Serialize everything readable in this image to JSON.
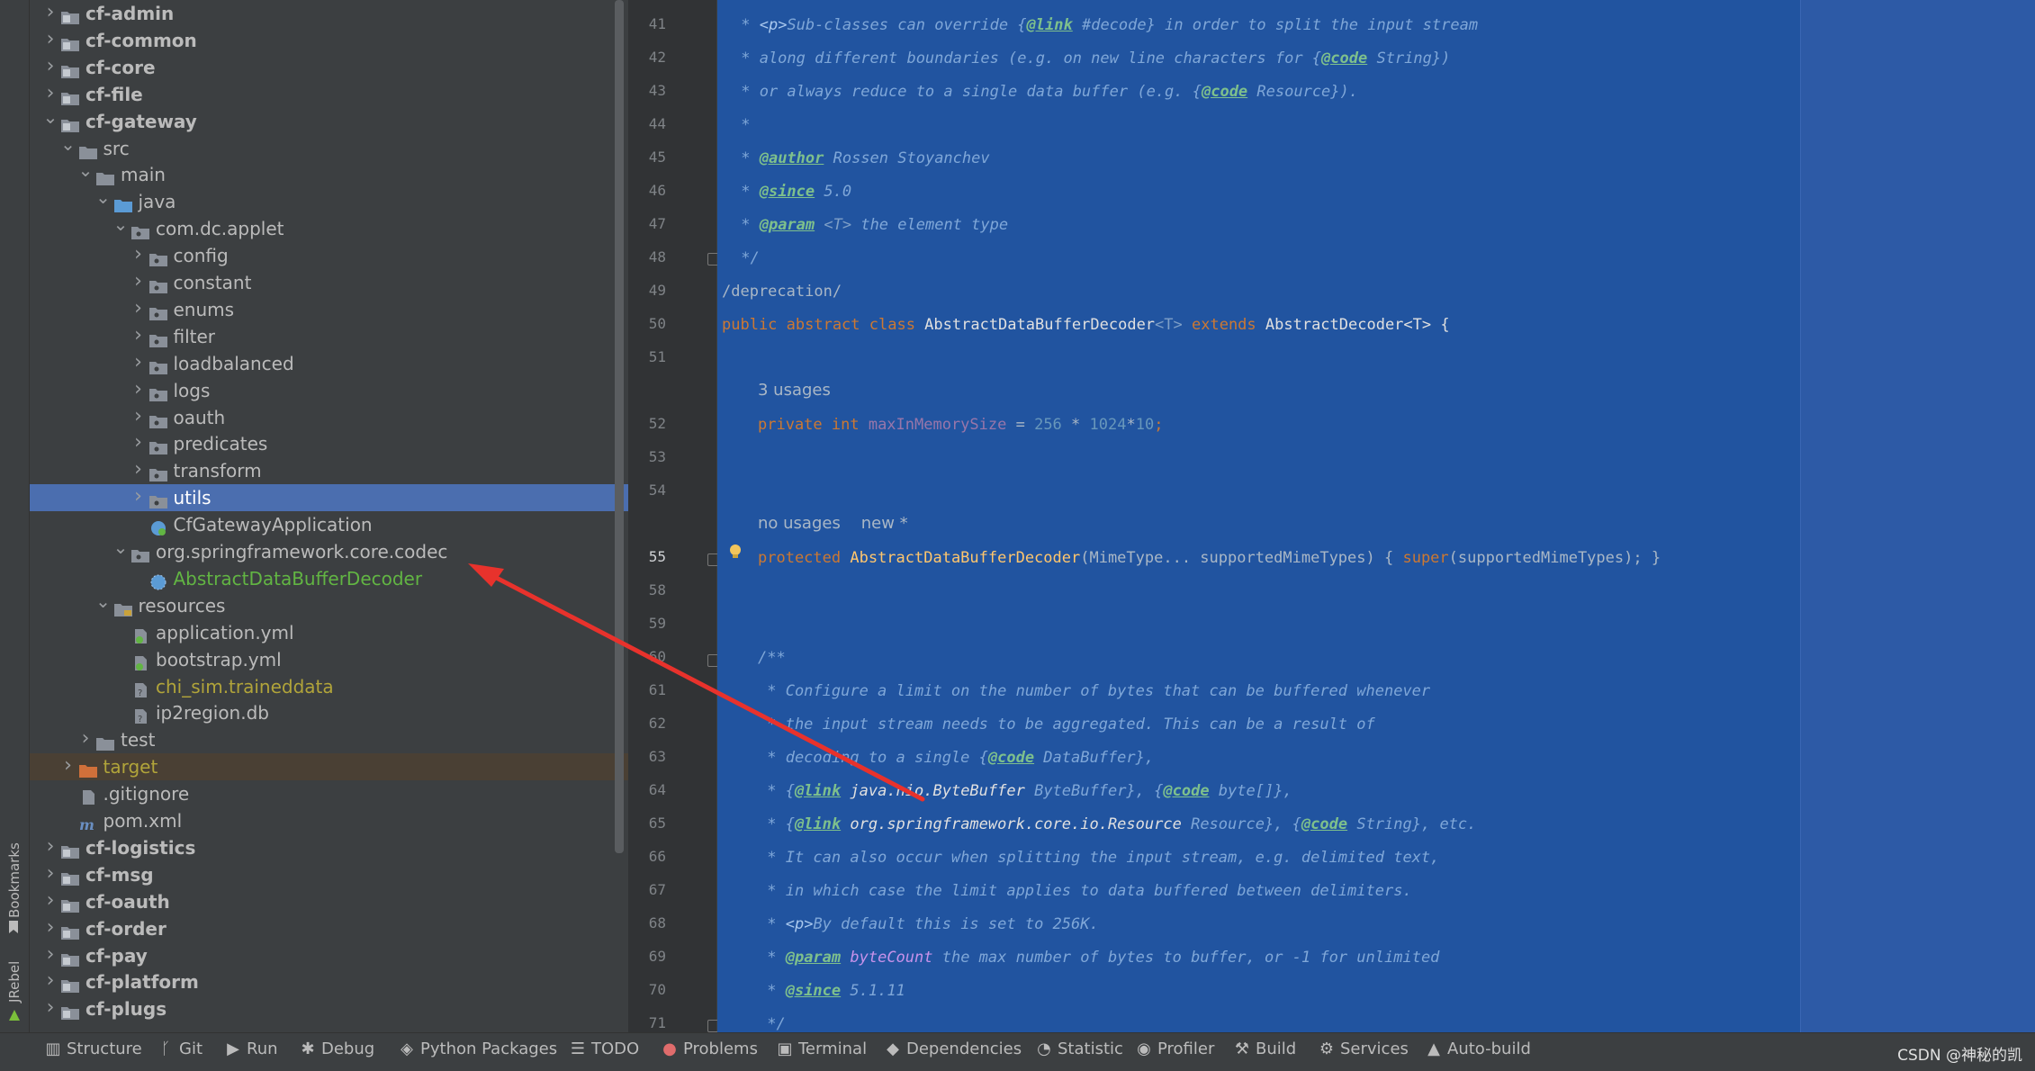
{
  "left_strip": {
    "bookmarks_label": "Bookmarks",
    "jrebel_label": "JRebel"
  },
  "project_tree": [
    {
      "name": "cf-admin",
      "level": 0,
      "arrow": "right",
      "icon": "module",
      "bold": true
    },
    {
      "name": "cf-common",
      "level": 0,
      "arrow": "right",
      "icon": "module",
      "bold": true
    },
    {
      "name": "cf-core",
      "level": 0,
      "arrow": "right",
      "icon": "module",
      "bold": true
    },
    {
      "name": "cf-file",
      "level": 0,
      "arrow": "right",
      "icon": "module",
      "bold": true
    },
    {
      "name": "cf-gateway",
      "level": 0,
      "arrow": "down",
      "icon": "module",
      "bold": true
    },
    {
      "name": "src",
      "level": 1,
      "arrow": "down",
      "icon": "folder"
    },
    {
      "name": "main",
      "level": 2,
      "arrow": "down",
      "icon": "folder"
    },
    {
      "name": "java",
      "level": 3,
      "arrow": "down",
      "icon": "source-folder"
    },
    {
      "name": "com.dc.applet",
      "level": 4,
      "arrow": "down",
      "icon": "package"
    },
    {
      "name": "config",
      "level": 5,
      "arrow": "right",
      "icon": "package"
    },
    {
      "name": "constant",
      "level": 5,
      "arrow": "right",
      "icon": "package"
    },
    {
      "name": "enums",
      "level": 5,
      "arrow": "right",
      "icon": "package"
    },
    {
      "name": "filter",
      "level": 5,
      "arrow": "right",
      "icon": "package"
    },
    {
      "name": "loadbalanced",
      "level": 5,
      "arrow": "right",
      "icon": "package"
    },
    {
      "name": "logs",
      "level": 5,
      "arrow": "right",
      "icon": "package"
    },
    {
      "name": "oauth",
      "level": 5,
      "arrow": "right",
      "icon": "package"
    },
    {
      "name": "predicates",
      "level": 5,
      "arrow": "right",
      "icon": "package"
    },
    {
      "name": "transform",
      "level": 5,
      "arrow": "right",
      "icon": "package"
    },
    {
      "name": "utils",
      "level": 5,
      "arrow": "right",
      "icon": "package",
      "selected": true
    },
    {
      "name": "CfGatewayApplication",
      "level": 5,
      "arrow": "none",
      "icon": "spring-class"
    },
    {
      "name": "org.springframework.core.codec",
      "level": 4,
      "arrow": "down",
      "icon": "package"
    },
    {
      "name": "AbstractDataBufferDecoder",
      "level": 5,
      "arrow": "none",
      "icon": "abstract-class",
      "color": "green"
    },
    {
      "name": "resources",
      "level": 3,
      "arrow": "down",
      "icon": "resources-folder"
    },
    {
      "name": "application.yml",
      "level": 4,
      "arrow": "none",
      "icon": "yml-file"
    },
    {
      "name": "bootstrap.yml",
      "level": 4,
      "arrow": "none",
      "icon": "yml-file"
    },
    {
      "name": "chi_sim.traineddata",
      "level": 4,
      "arrow": "none",
      "icon": "unknown-file",
      "color": "yellow"
    },
    {
      "name": "ip2region.db",
      "level": 4,
      "arrow": "none",
      "icon": "unknown-file"
    },
    {
      "name": "test",
      "level": 2,
      "arrow": "right",
      "icon": "folder"
    },
    {
      "name": "target",
      "level": 1,
      "arrow": "right",
      "icon": "excluded-folder",
      "color": "yellow",
      "excluded": true
    },
    {
      "name": ".gitignore",
      "level": 1,
      "arrow": "none",
      "icon": "text-file"
    },
    {
      "name": "pom.xml",
      "level": 1,
      "arrow": "none",
      "icon": "maven-file"
    },
    {
      "name": "cf-logistics",
      "level": 0,
      "arrow": "right",
      "icon": "module",
      "bold": true
    },
    {
      "name": "cf-msg",
      "level": 0,
      "arrow": "right",
      "icon": "module",
      "bold": true
    },
    {
      "name": "cf-oauth",
      "level": 0,
      "arrow": "right",
      "icon": "module",
      "bold": true
    },
    {
      "name": "cf-order",
      "level": 0,
      "arrow": "right",
      "icon": "module",
      "bold": true
    },
    {
      "name": "cf-pay",
      "level": 0,
      "arrow": "right",
      "icon": "module",
      "bold": true
    },
    {
      "name": "cf-platform",
      "level": 0,
      "arrow": "right",
      "icon": "module",
      "bold": true
    },
    {
      "name": "cf-plugs",
      "level": 0,
      "arrow": "right",
      "icon": "module",
      "bold": true
    }
  ],
  "line_numbers": [
    {
      "n": "41"
    },
    {
      "n": "42"
    },
    {
      "n": "43"
    },
    {
      "n": "44"
    },
    {
      "n": "45"
    },
    {
      "n": "46"
    },
    {
      "n": "47"
    },
    {
      "n": "48"
    },
    {
      "n": "49"
    },
    {
      "n": "50"
    },
    {
      "n": "51"
    },
    {
      "n": "52"
    },
    {
      "n": "53"
    },
    {
      "n": "54"
    },
    {
      "n": "55"
    },
    {
      "n": "58"
    },
    {
      "n": "59"
    },
    {
      "n": "60"
    },
    {
      "n": "61"
    },
    {
      "n": "62"
    },
    {
      "n": "63"
    },
    {
      "n": "64"
    },
    {
      "n": "65"
    },
    {
      "n": "66"
    },
    {
      "n": "67"
    },
    {
      "n": "68"
    },
    {
      "n": "69"
    },
    {
      "n": "70"
    },
    {
      "n": "71"
    }
  ],
  "code": {
    "l41": {
      "a": " * ",
      "b": "<p>",
      "c": "Sub-classes can override {",
      "d": "@link",
      "e": " #decode} in order to split the input stream"
    },
    "l42": {
      "a": " * along different boundaries (e.g. on new line characters for {",
      "b": "@code",
      "c": " String})"
    },
    "l43": {
      "a": " * or always reduce to a single data buffer (e.g. {",
      "b": "@code",
      "c": " Resource})."
    },
    "l44": " *",
    "l45": {
      "a": " * ",
      "b": "@author",
      "c": " Rossen Stoyanchev"
    },
    "l46": {
      "a": " * ",
      "b": "@since",
      "c": " 5.0"
    },
    "l47": {
      "a": " * ",
      "b": "@param",
      "c": " <T>",
      "d": " the element type"
    },
    "l48": " */",
    "l49": "/deprecation/",
    "l50": {
      "a": "public abstract class ",
      "b": "AbstractDataBufferDecoder",
      "c": "<T> ",
      "d": "extends ",
      "e": "AbstractDecoder",
      "f": "<T> {"
    },
    "usages1": "3 usages",
    "l52": {
      "a": "private int ",
      "b": "maxInMemorySize",
      "c": " = ",
      "d": "256",
      "e": " * ",
      "f": "1024",
      "g": "*",
      "h": "10",
      ";": ";"
    },
    "usages2": "no usages",
    "new_tag": "new *",
    "l55": {
      "a": "protected ",
      "b": "AbstractDataBufferDecoder",
      "c": "(MimeType... supportedMimeTypes) { ",
      "d": "super",
      "e": "(supportedMimeTypes); }"
    },
    "l60": "/**",
    "l61": " * Configure a limit on the number of bytes that can be buffered whenever",
    "l62": " * the input stream needs to be aggregated. This can be a result of",
    "l63": {
      "a": " * decoding to a single {",
      "b": "@code",
      "c": " DataBuffer},"
    },
    "l64": {
      "a": " * {",
      "b": "@link",
      "c": " java.nio.ByteBuffer",
      "d": " ByteBuffer}, {",
      "e": "@code",
      "f": " byte[]},"
    },
    "l65": {
      "a": " * {",
      "b": "@link",
      "c": " org.springframework.core.io.Resource",
      "d": " Resource}, {",
      "e": "@code",
      "f": " String}, etc."
    },
    "l66": " * It can also occur when splitting the input stream, e.g. delimited text,",
    "l67": " * in which case the limit applies to data buffered between delimiters.",
    "l68": {
      "a": " * ",
      "b": "<p>",
      "c": "By default this is set to 256K."
    },
    "l69": {
      "a": " * ",
      "b": "@param",
      "c": " byteCount",
      "d": " the max number of bytes to buffer, or -1 for unlimited"
    },
    "l70": {
      "a": " * ",
      "b": "@since",
      "c": " 5.1.11"
    },
    "l71": " */"
  },
  "toolbar": [
    {
      "label": "Structure",
      "icon": "structure-icon"
    },
    {
      "label": "Git",
      "icon": "git-icon"
    },
    {
      "label": "Run",
      "icon": "run-icon"
    },
    {
      "label": "Debug",
      "icon": "debug-icon"
    },
    {
      "label": "Python Packages",
      "icon": "packages-icon"
    },
    {
      "label": "TODO",
      "icon": "todo-icon"
    },
    {
      "label": "Problems",
      "icon": "problems-icon"
    },
    {
      "label": "Terminal",
      "icon": "terminal-icon"
    },
    {
      "label": "Dependencies",
      "icon": "dependencies-icon"
    },
    {
      "label": "Statistic",
      "icon": "statistic-icon"
    },
    {
      "label": "Profiler",
      "icon": "profiler-icon"
    },
    {
      "label": "Build",
      "icon": "build-icon"
    },
    {
      "label": "Services",
      "icon": "services-icon"
    },
    {
      "label": "Auto-build",
      "icon": "auto-build-icon"
    }
  ],
  "watermark": "CSDN @神秘的凯",
  "colors": {
    "editor_selection": "#2154a0",
    "tree_selection": "#4b6eaf",
    "annotation_arrow": "#e8322c"
  }
}
